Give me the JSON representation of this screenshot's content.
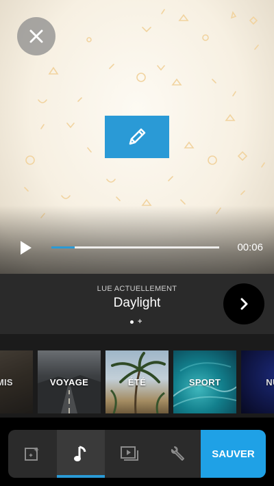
{
  "preview": {
    "current_time": "00:06",
    "progress_fraction": 0.14
  },
  "now_playing": {
    "caption": "LUE ACTUELLEMENT",
    "title": "Daylight",
    "plus_symbol": "+"
  },
  "themes": [
    {
      "label": "AMIS"
    },
    {
      "label": "VOYAGE"
    },
    {
      "label": "ÉTÉ"
    },
    {
      "label": "SPORT"
    },
    {
      "label": "NU"
    }
  ],
  "toolbar": {
    "save_label": "SAUVER",
    "accent_color": "#2a9ad6",
    "save_color": "#1fa1e6"
  }
}
